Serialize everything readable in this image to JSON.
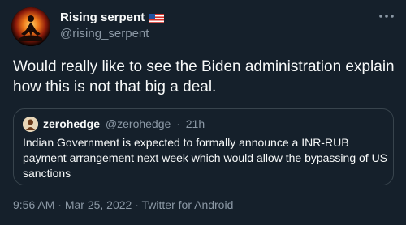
{
  "author": {
    "display_name": "Rising serpent",
    "handle": "@rising_serpent",
    "avatar_icon": "meditating-figure-fire-avatar",
    "flag_icon": "us-flag-icon"
  },
  "tweet": {
    "text": "Would really like to see the Biden administration explain how this is not that big a deal."
  },
  "quote": {
    "display_name": "zerohedge",
    "handle": "@zerohedge",
    "separator": "·",
    "time_ago": "21h",
    "text": "Indian Government is expected to formally announce a INR-RUB payment arrangement next week which would allow the bypassing of US sanctions",
    "avatar_icon": "zerohedge-logo-avatar"
  },
  "meta": {
    "time": "9:56 AM",
    "sep1": "·",
    "date": "Mar 25, 2022",
    "sep2": "·",
    "source": "Twitter for Android"
  },
  "colors": {
    "background": "#15202b",
    "text_primary": "#f7f9f9",
    "text_secondary": "#8b98a5",
    "border": "#38444d"
  }
}
